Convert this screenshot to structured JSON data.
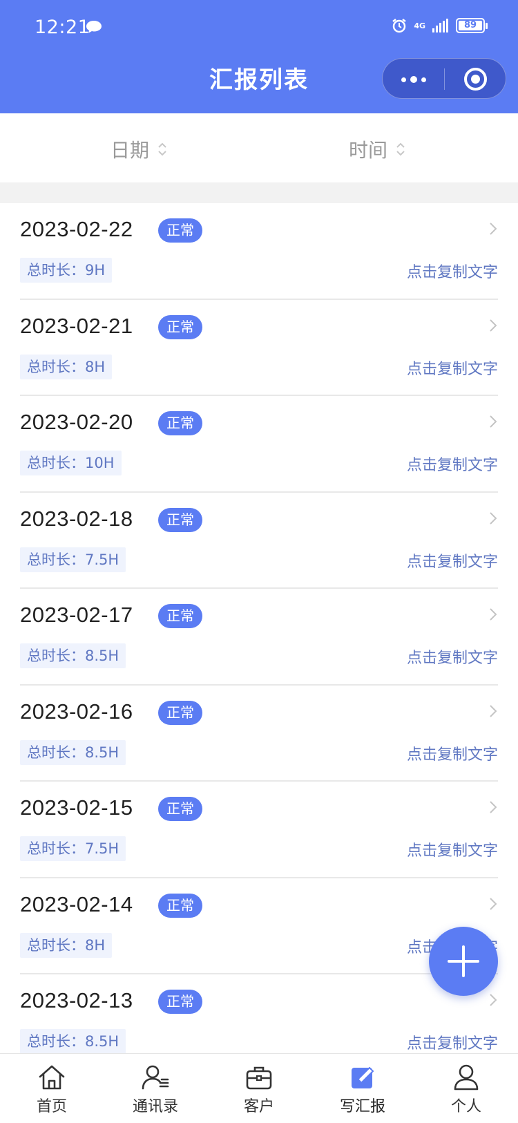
{
  "status_bar": {
    "time": "12:21",
    "network": "4G",
    "battery": "89"
  },
  "header": {
    "title": "汇报列表"
  },
  "sort": {
    "date_label": "日期",
    "time_label": "时间"
  },
  "reports": [
    {
      "date": "2023-02-22",
      "status": "正常",
      "duration": "总时长：9H",
      "copy_label": "点击复制文字"
    },
    {
      "date": "2023-02-21",
      "status": "正常",
      "duration": "总时长：8H",
      "copy_label": "点击复制文字"
    },
    {
      "date": "2023-02-20",
      "status": "正常",
      "duration": "总时长：10H",
      "copy_label": "点击复制文字"
    },
    {
      "date": "2023-02-18",
      "status": "正常",
      "duration": "总时长：7.5H",
      "copy_label": "点击复制文字"
    },
    {
      "date": "2023-02-17",
      "status": "正常",
      "duration": "总时长：8.5H",
      "copy_label": "点击复制文字"
    },
    {
      "date": "2023-02-16",
      "status": "正常",
      "duration": "总时长：8.5H",
      "copy_label": "点击复制文字"
    },
    {
      "date": "2023-02-15",
      "status": "正常",
      "duration": "总时长：7.5H",
      "copy_label": "点击复制文字"
    },
    {
      "date": "2023-02-14",
      "status": "正常",
      "duration": "总时长：8H",
      "copy_label": "点击复制文字"
    },
    {
      "date": "2023-02-13",
      "status": "正常",
      "duration": "总时长：8.5H",
      "copy_label": "点击复制文字"
    }
  ],
  "tabbar": {
    "items": [
      {
        "label": "首页",
        "icon": "home-icon",
        "active": false
      },
      {
        "label": "通讯录",
        "icon": "contacts-icon",
        "active": false
      },
      {
        "label": "客户",
        "icon": "briefcase-icon",
        "active": false
      },
      {
        "label": "写汇报",
        "icon": "edit-icon",
        "active": true
      },
      {
        "label": "个人",
        "icon": "person-icon",
        "active": false
      }
    ]
  },
  "colors": {
    "primary": "#5b7cf3",
    "link": "#5f77c2",
    "duration_bg": "#eff3fd"
  }
}
